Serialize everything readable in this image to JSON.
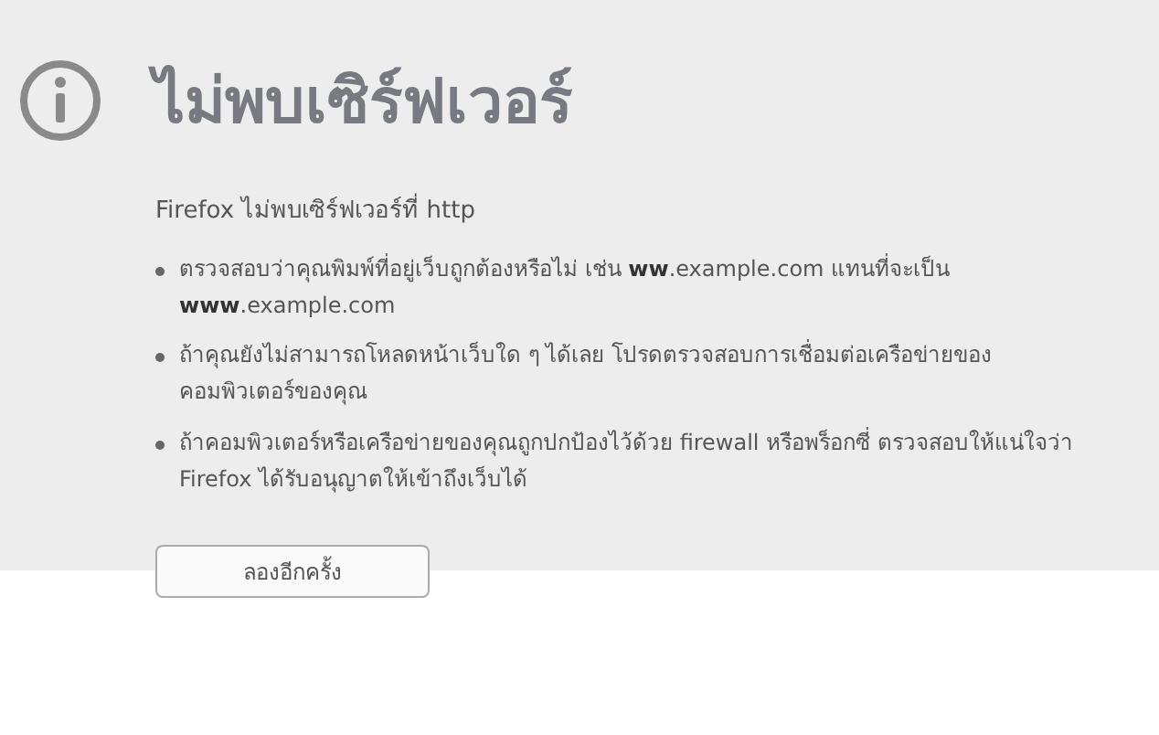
{
  "title": "ไม่พบเซิร์ฟเวอร์",
  "message": "Firefox ไม่พบเซิร์ฟเวอร์ที่ http",
  "suggestions": [
    "ตรวจสอบว่าคุณพิมพ์ที่อยู่เว็บถูกต้องหรือไม่ เช่น **ww**.example.com แทนที่จะเป็น **www**.example.com",
    "ถ้าคุณยังไม่สามารถโหลดหน้าเว็บใด ๆ ได้เลย โปรดตรวจสอบการเชื่อมต่อเครือข่ายของคอมพิวเตอร์ของคุณ",
    "ถ้าคอมพิวเตอร์หรือเครือข่ายของคุณถูกปกป้องไว้ด้วย firewall หรือพร็อกซี่ ตรวจสอบให้แน่ใจว่า Firefox ได้รับอนุญาตให้เข้าถึงเว็บได้"
  ],
  "button": "ลองอีกครั้ง"
}
